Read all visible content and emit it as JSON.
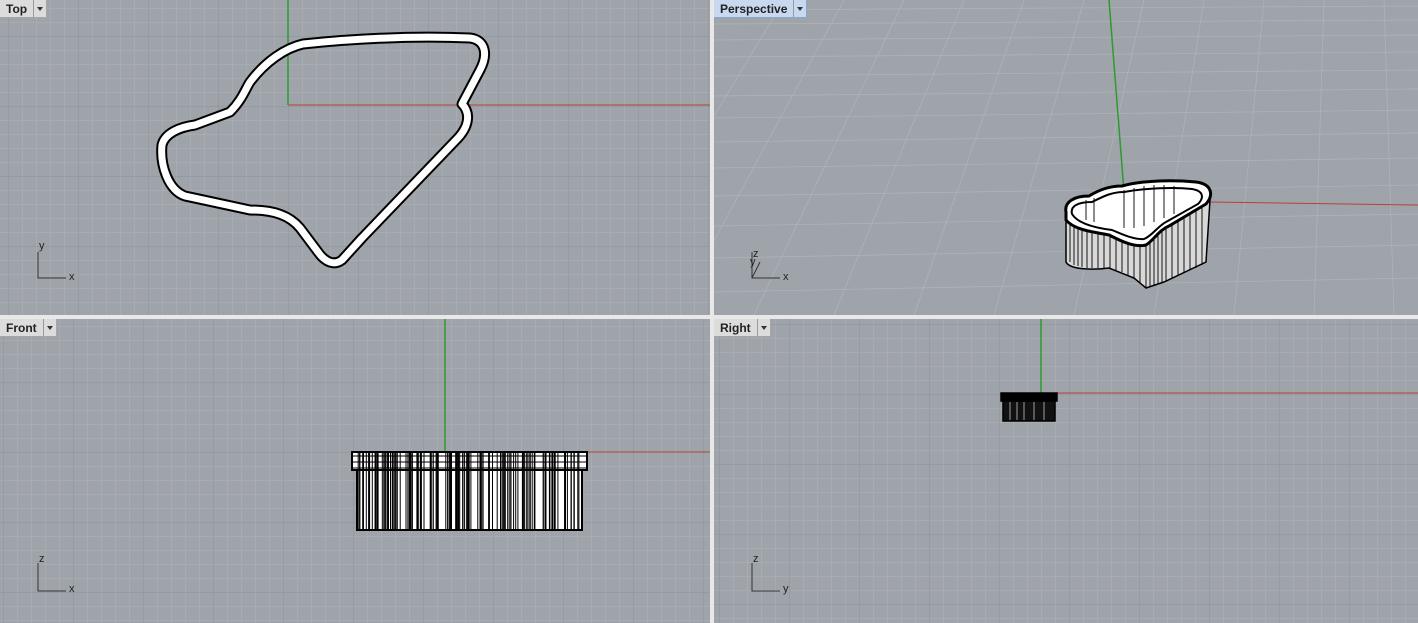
{
  "viewports": {
    "top": {
      "name": "Top",
      "axis_x": "x",
      "axis_y": "y"
    },
    "perspective": {
      "name": "Perspective",
      "axis_x": "x",
      "axis_y": "y",
      "axis_z": "z"
    },
    "front": {
      "name": "Front",
      "axis_x": "x",
      "axis_y": "z"
    },
    "right": {
      "name": "Right",
      "axis_x": "y",
      "axis_y": "z"
    }
  },
  "colors": {
    "viewport_bg": "#9fa4ab",
    "grid_minor": "#b0b4ba",
    "grid_major": "#8c9097",
    "axis_x": "#b8413a",
    "axis_y": "#2d9b2d",
    "geometry": "#000000",
    "active_tab": "#c8d8ee"
  },
  "icons": {
    "viewport_menu": "chevron-down-icon",
    "world_axes": "axes-widget-icon"
  }
}
